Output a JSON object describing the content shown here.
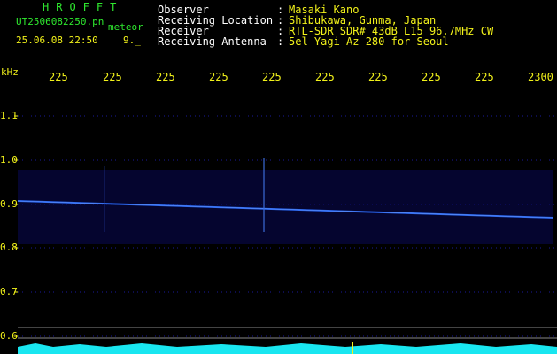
{
  "header": {
    "title": "HROFFT",
    "filename": "UT2506082250.pn",
    "meteor_label": "meteor",
    "datetime": "25.06.08 22:50",
    "count": "9._",
    "fields": [
      {
        "label": "Observer",
        "value": "Masaki Kano"
      },
      {
        "label": "Receiving Location",
        "value": "Shibukawa, Gunma, Japan"
      },
      {
        "label": "Receiver",
        "value": "RTL-SDR SDR# 43dB L15 96.7MHz CW"
      },
      {
        "label": "Receiving Antenna",
        "value": "5el Yagi Az 280 for Seoul"
      }
    ]
  },
  "axes": {
    "x_unit": "kHz",
    "x_ticks": [
      "225",
      "225",
      "225",
      "225",
      "225",
      "225",
      "225",
      "225",
      "225",
      "2300"
    ],
    "y_ticks": [
      "1.1",
      "1.0",
      "0.9",
      "0.8",
      "0.7",
      "0.6"
    ]
  },
  "colors": {
    "background": "#000000",
    "header_green": "#2ee82e",
    "header_yellow": "#f2f21a",
    "trace_blue": "#2a6cff",
    "baseline_cyan": "#19e6f0"
  }
}
